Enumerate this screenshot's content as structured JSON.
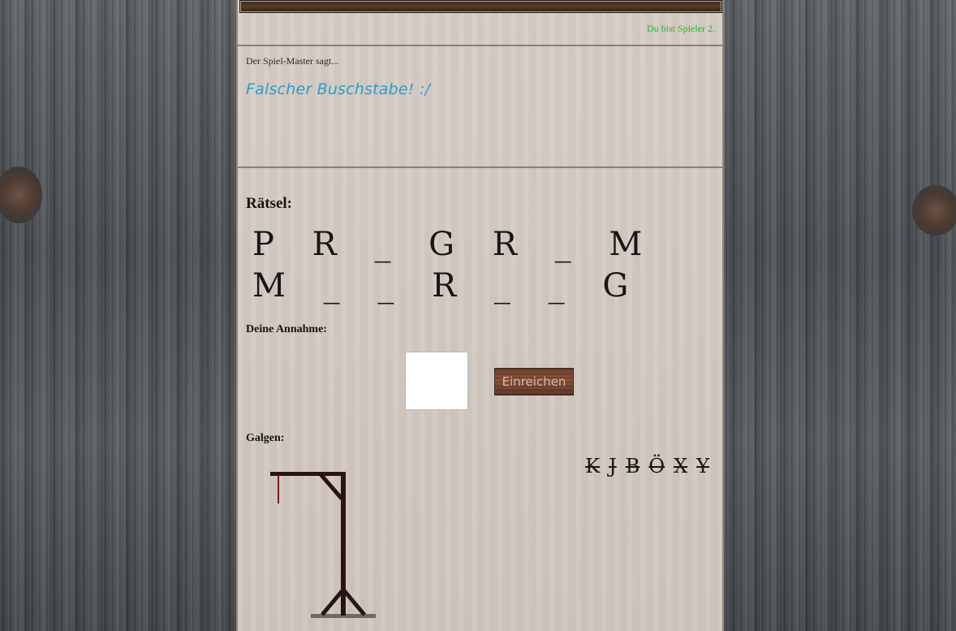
{
  "status": {
    "player_text": "Du bist Spieler 2."
  },
  "game_master": {
    "intro": "Der Spiel-Master sagt...",
    "message": "Falscher Buschstabe! :/"
  },
  "puzzle": {
    "heading": "Rätsel:",
    "display": "P R _ G R _ M M _ _ R _ _ G"
  },
  "guess": {
    "label": "Deine Annahme:",
    "input_value": "",
    "submit_label": "Einreichen"
  },
  "gallows": {
    "label": "Galgen:"
  },
  "wrong_letters": [
    "K",
    "J",
    "B",
    "Ö",
    "X",
    "Y"
  ],
  "colors": {
    "status_green": "#2db52d",
    "message_blue": "#2c9bd0",
    "gallows_wood": "#2a1410",
    "gallows_base": "#6b6b6b"
  }
}
